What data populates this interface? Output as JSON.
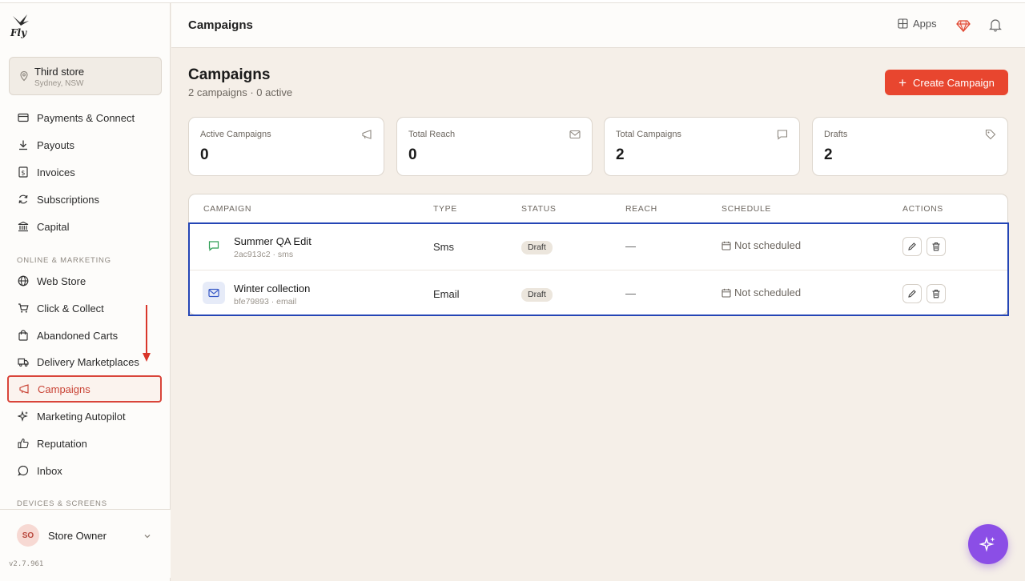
{
  "app": {
    "brand": "Fly"
  },
  "store": {
    "name": "Third store",
    "location": "Sydney, NSW"
  },
  "sidebar": {
    "items": [
      {
        "label": "Payments & Connect",
        "icon": "card-icon"
      },
      {
        "label": "Payouts",
        "icon": "download-icon"
      },
      {
        "label": "Invoices",
        "icon": "invoice-icon"
      },
      {
        "label": "Subscriptions",
        "icon": "refresh-icon"
      },
      {
        "label": "Capital",
        "icon": "bank-icon"
      }
    ],
    "section_marketing": "ONLINE & MARKETING",
    "marketing_items": [
      {
        "label": "Web Store",
        "icon": "globe-icon"
      },
      {
        "label": "Click & Collect",
        "icon": "cart-icon"
      },
      {
        "label": "Abandoned Carts",
        "icon": "bag-icon"
      },
      {
        "label": "Delivery Marketplaces",
        "icon": "truck-icon"
      },
      {
        "label": "Campaigns",
        "icon": "megaphone-icon",
        "active": true
      },
      {
        "label": "Marketing Autopilot",
        "icon": "sparkle-icon"
      },
      {
        "label": "Reputation",
        "icon": "thumbs-up-icon"
      },
      {
        "label": "Inbox",
        "icon": "chat-icon"
      }
    ],
    "section_devices": "DEVICES & SCREENS",
    "user": {
      "initials": "SO",
      "name": "Store Owner"
    },
    "version": "v2.7.961"
  },
  "header": {
    "title": "Campaigns",
    "apps_label": "Apps"
  },
  "main": {
    "title": "Campaigns",
    "subtitle": "2 campaigns · 0 active",
    "create_label": "Create Campaign",
    "stats": [
      {
        "label": "Active Campaigns",
        "value": "0",
        "icon": "megaphone-icon"
      },
      {
        "label": "Total Reach",
        "value": "0",
        "icon": "mail-icon"
      },
      {
        "label": "Total Campaigns",
        "value": "2",
        "icon": "chat-icon"
      },
      {
        "label": "Drafts",
        "value": "2",
        "icon": "tag-icon"
      }
    ],
    "table": {
      "headers": [
        "CAMPAIGN",
        "TYPE",
        "STATUS",
        "REACH",
        "SCHEDULE",
        "ACTIONS"
      ],
      "rows": [
        {
          "name": "Summer QA Edit",
          "meta": "2ac913c2 · sms",
          "type": "Sms",
          "status": "Draft",
          "reach": "—",
          "schedule": "Not scheduled",
          "channel_icon": "sms-icon"
        },
        {
          "name": "Winter collection",
          "meta": "bfe79893 · email",
          "type": "Email",
          "status": "Draft",
          "reach": "—",
          "schedule": "Not scheduled",
          "channel_icon": "mail-icon"
        }
      ]
    }
  },
  "colors": {
    "accent": "#e8462f",
    "highlight": "#2445b5",
    "fab": "#8b4ee6"
  }
}
